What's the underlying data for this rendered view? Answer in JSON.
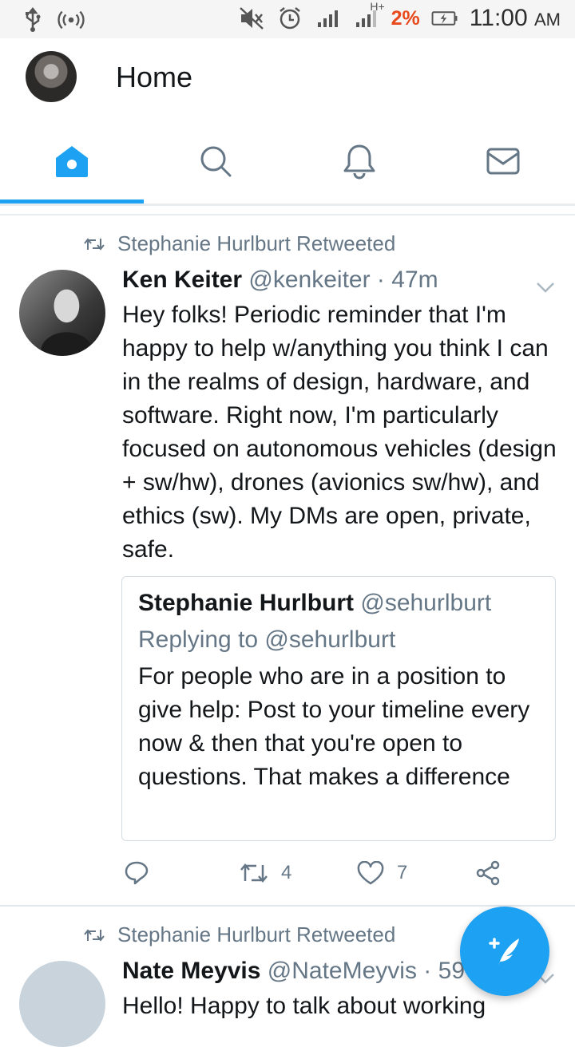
{
  "status_bar": {
    "battery_percent": "2%",
    "time": "11:00",
    "ampm": "AM",
    "network_label": "H+",
    "icons": [
      "usb-icon",
      "hotspot-icon",
      "mute-icon",
      "alarm-icon",
      "signal-icon",
      "signal-h-plus-icon",
      "battery-charging-icon"
    ]
  },
  "header": {
    "title": "Home"
  },
  "tabs": [
    {
      "name": "home",
      "icon": "home-icon",
      "active": true
    },
    {
      "name": "search",
      "icon": "search-icon",
      "active": false
    },
    {
      "name": "notifications",
      "icon": "bell-icon",
      "active": false
    },
    {
      "name": "messages",
      "icon": "mail-icon",
      "active": false
    }
  ],
  "colors": {
    "accent": "#1da1f2",
    "secondary_text": "#657786",
    "primary_text": "#14171a",
    "battery_low": "#e8491d"
  },
  "tweets": [
    {
      "retweeted_by": "Stephanie Hurlburt Retweeted",
      "name": "Ken Keiter",
      "handle": "@kenkeiter",
      "separator": "·",
      "time": "47m",
      "text": "Hey folks! Periodic reminder that I'm happy to help w/anything you think I can in the realms of design, hardware, and software. Right now, I'm particularly focused on autonomous vehicles (design + sw/hw), drones (avionics sw/hw), and ethics (sw). My DMs are open, private, safe.",
      "quote": {
        "name": "Stephanie Hurlburt",
        "handle": "@sehurlburt",
        "reply_to": "Replying to @sehurlburt",
        "text": "For people who are in a position to give help: Post to your timeline every now & then that you're open to questions. That makes a difference"
      },
      "actions": {
        "retweets": "4",
        "likes": "7"
      }
    },
    {
      "retweeted_by": "Stephanie Hurlburt Retweeted",
      "name": "Nate Meyvis",
      "handle": "@NateMeyvis",
      "separator": "·",
      "time": "59",
      "text": "Hello! Happy to talk about working"
    }
  ],
  "fab": {
    "icon": "compose-tweet-icon"
  }
}
